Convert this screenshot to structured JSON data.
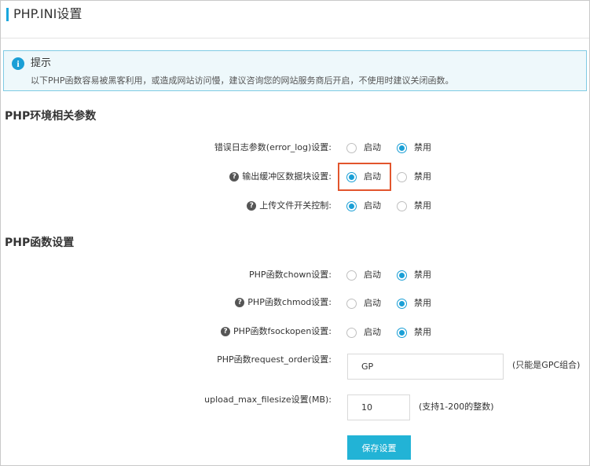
{
  "header": {
    "title": "PHP.INI设置"
  },
  "notice": {
    "icon": "info-icon",
    "title": "提示",
    "text": "以下PHP函数容易被黑客利用，或造成网站访问慢，建议咨询您的网站服务商后开启，不使用时建议关闭函数。"
  },
  "env_section": {
    "title": "PHP环境相关参数",
    "rows": [
      {
        "label": "错误日志参数(error_log)设置:",
        "help": false,
        "on_label": "启动",
        "off_label": "禁用",
        "selected": "off"
      },
      {
        "label": "输出缓冲区数据块设置:",
        "help": true,
        "on_label": "启动",
        "off_label": "禁用",
        "selected": "on"
      },
      {
        "label": "上传文件开关控制:",
        "help": true,
        "on_label": "启动",
        "off_label": "禁用",
        "selected": "on"
      }
    ]
  },
  "func_section": {
    "title": "PHP函数设置",
    "rows": [
      {
        "label": "PHP函数chown设置:",
        "help": false,
        "on_label": "启动",
        "off_label": "禁用",
        "selected": "off"
      },
      {
        "label": "PHP函数chmod设置:",
        "help": true,
        "on_label": "启动",
        "off_label": "禁用",
        "selected": "off"
      },
      {
        "label": "PHP函数fsockopen设置:",
        "help": true,
        "on_label": "启动",
        "off_label": "禁用",
        "selected": "off"
      }
    ],
    "request_order": {
      "label": "PHP函数request_order设置:",
      "value": "GP",
      "hint": "(只能是GPC组合)"
    },
    "upload_max": {
      "label": "upload_max_filesize设置(MB):",
      "value": "10",
      "hint": "(支持1-200的整数)"
    }
  },
  "save_button": {
    "label": "保存设置"
  },
  "colors": {
    "accent": "#1a9fd6",
    "button": "#22b3d6",
    "highlight": "#e2552d",
    "notice_bg": "#eef8fb"
  }
}
